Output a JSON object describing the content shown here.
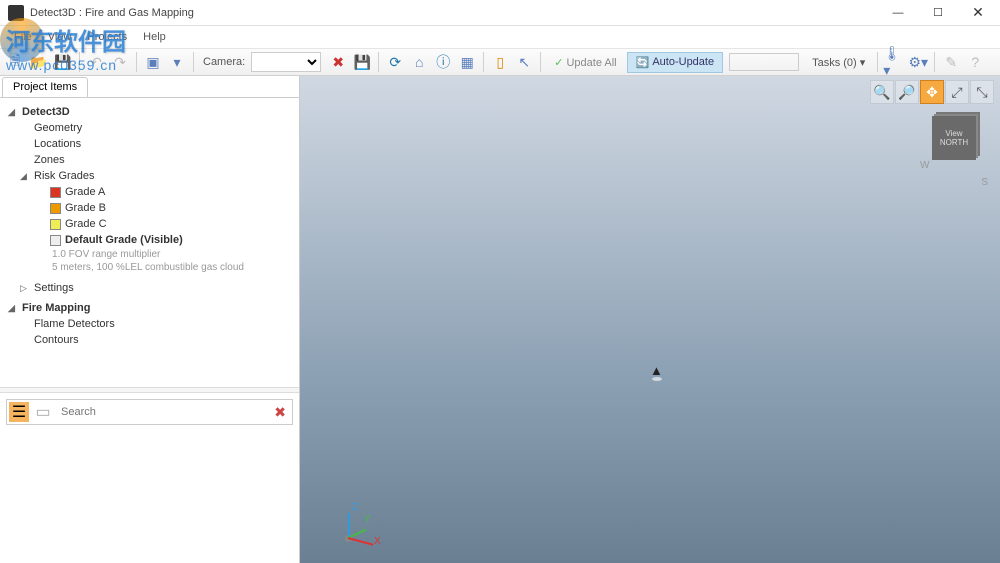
{
  "window": {
    "title": "Detect3D : Fire and Gas Mapping"
  },
  "menu": {
    "file": "File",
    "view": "View",
    "projects": "Projects",
    "help": "Help"
  },
  "toolbar": {
    "camera_label": "Camera:",
    "update_all": "Update All",
    "auto_update": "Auto-Update",
    "tasks": "Tasks (0)"
  },
  "sidebar": {
    "tab": "Project Items",
    "root": "Detect3D",
    "items": {
      "geometry": "Geometry",
      "locations": "Locations",
      "zones": "Zones",
      "risk_grades": "Risk Grades",
      "grade_a": "Grade A",
      "grade_b": "Grade B",
      "grade_c": "Grade C",
      "default_grade": "Default Grade (Visible)",
      "default_sub1": "1.0 FOV range multiplier",
      "default_sub2": "5 meters, 100 %LEL combustible gas cloud",
      "settings": "Settings",
      "fire_mapping": "Fire Mapping",
      "flame_detectors": "Flame Detectors",
      "contours": "Contours"
    },
    "search_placeholder": "Search"
  },
  "navcube": {
    "face": "View NORTH",
    "w": "W",
    "s": "S"
  },
  "axes": {
    "x": "X",
    "y": "Y",
    "z": "Z"
  },
  "watermark": {
    "text": "河东软件园",
    "url": "www.pc0359.cn"
  }
}
